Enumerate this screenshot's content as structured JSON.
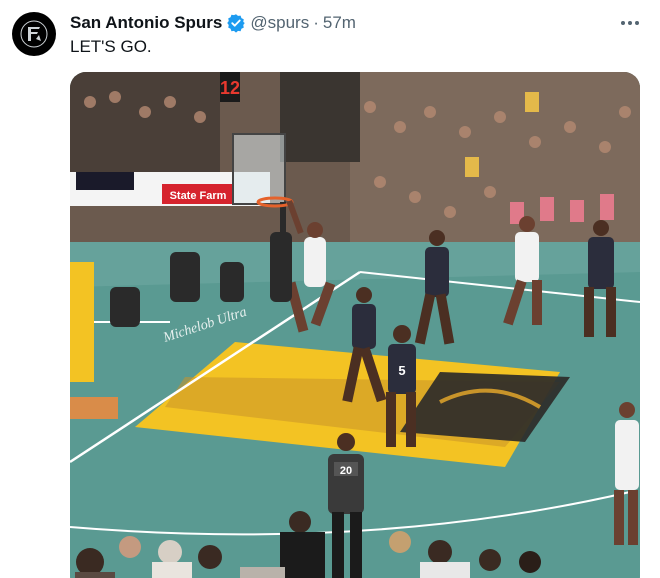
{
  "tweet": {
    "author_name": "San Antonio Spurs",
    "handle": "@spurs",
    "separator": "·",
    "time": "57m",
    "text": "LET'S GO.",
    "verified_color": "#1d9bf0"
  },
  "icons": {
    "avatar": "spurs-logo-icon",
    "verified": "verified-badge-icon",
    "more": "more-options-icon"
  },
  "media": {
    "shot_clock": "12",
    "baseline_ad": "State Farm",
    "court_logo": "Michelob Ultra",
    "player_numbers": [
      "5",
      "20"
    ],
    "colors": {
      "court": "#5a9a92",
      "paint": "#f3c323",
      "crowd": "#6b5a4e"
    }
  }
}
